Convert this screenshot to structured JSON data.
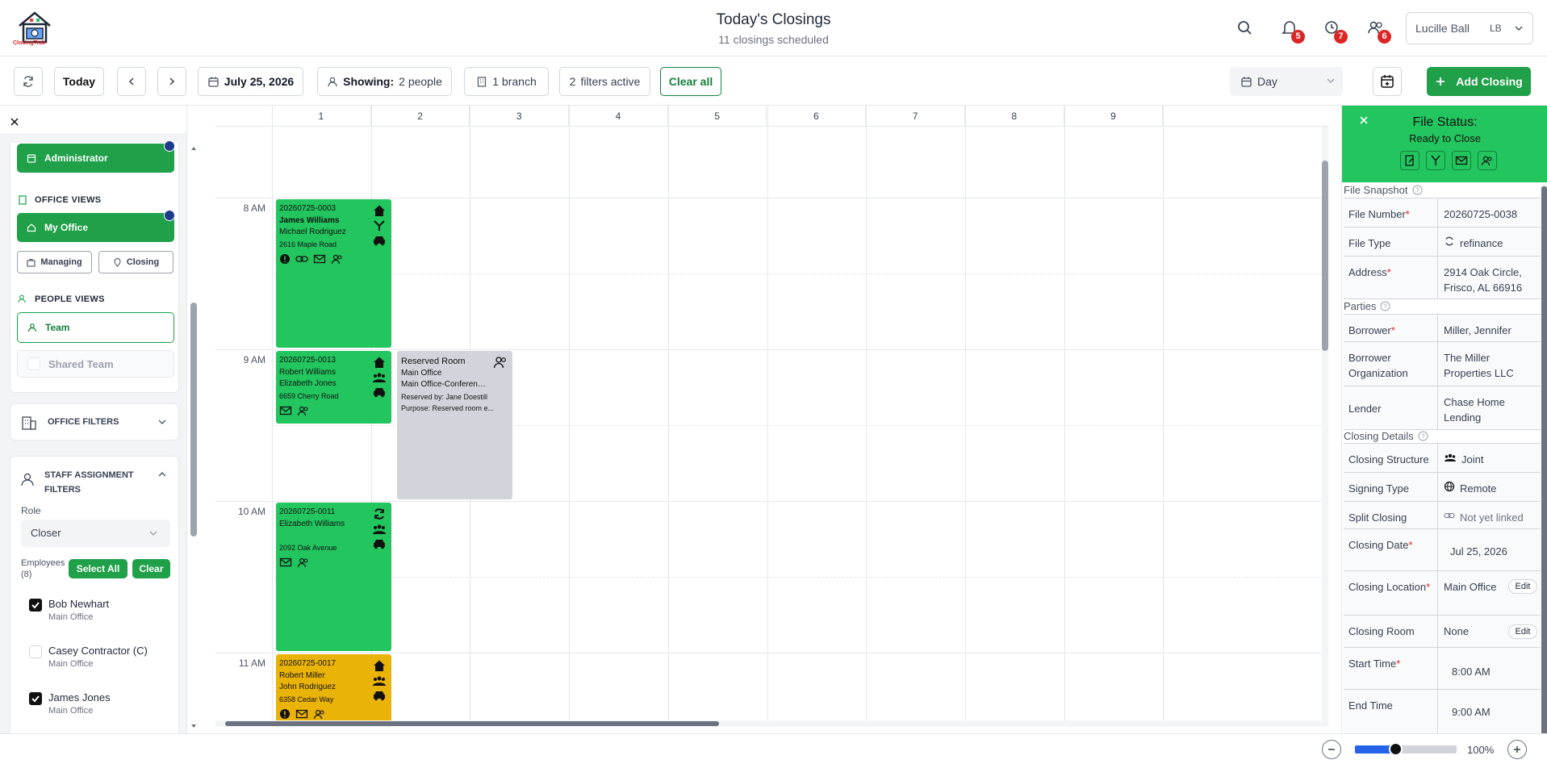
{
  "header": {
    "logo_text": "ClosingTrak",
    "title": "Today's Closings",
    "subtitle": "11 closings scheduled",
    "notifications_count": "5",
    "alerts_count": "7",
    "people_count": "6",
    "user_name": "Lucille Ball",
    "user_initials": "LB"
  },
  "toolbar": {
    "today_label": "Today",
    "date_label": "July 25, 2026",
    "showing_label": "Showing:",
    "showing_value": "2 people",
    "branch_label": "1 branch",
    "filters_count": "2",
    "filters_label": "filters active",
    "clear_all_label": "Clear all",
    "view_label": "Day",
    "add_closing_label": "Add Closing"
  },
  "sidebar": {
    "administrator_label": "Administrator",
    "office_views_label": "OFFICE VIEWS",
    "my_office_label": "My Office",
    "managing_label": "Managing",
    "closing_label": "Closing",
    "people_views_label": "PEOPLE VIEWS",
    "team_label": "Team",
    "shared_team_label": "Shared Team",
    "office_filters_label": "OFFICE FILTERS",
    "staff_filters_label": "STAFF ASSIGNMENT FILTERS",
    "role_label": "Role",
    "role_value": "Closer",
    "employees_label": "Employees",
    "employees_count": "(8)",
    "select_all_label": "Select All",
    "clear_label": "Clear",
    "employees": [
      {
        "name": "Bob Newhart",
        "office": "Main Office",
        "checked": true
      },
      {
        "name": "Casey Contractor (C)",
        "office": "Main Office",
        "checked": false
      },
      {
        "name": "James Jones",
        "office": "Main Office",
        "checked": true
      }
    ]
  },
  "calendar": {
    "columns": [
      "1",
      "2",
      "3",
      "4",
      "5",
      "6",
      "7",
      "8",
      "9"
    ],
    "times": [
      "8 AM",
      "9 AM",
      "10 AM",
      "11 AM"
    ],
    "events": [
      {
        "file": "20260725-0003",
        "line1": "James Williams",
        "line2": "Michael Rodriguez",
        "address": "2616 Maple Road",
        "color": "#22c55e"
      },
      {
        "file": "20260725-0013",
        "line1": "Robert Williams",
        "line2": "Elizabeth Jones",
        "address": "6659 Cherry Road",
        "color": "#22c55e"
      },
      {
        "file": "20260725-0011",
        "line1": "Elizabeth Williams",
        "line2": "",
        "address": "2092 Oak Avenue",
        "color": "#22c55e"
      },
      {
        "file": "20260725-0017",
        "line1": "Robert Miller",
        "line2": "John Rodriguez",
        "address": "6358 Cedar Way",
        "color": "#eab308"
      }
    ],
    "reserved": {
      "title": "Reserved Room",
      "office": "Main Office",
      "room": "Main Office-Conferenc...",
      "reserved_by": "Reserved by: Jane Doestill",
      "purpose": "Purpose: Reserved room e...",
      "color": "#d1d5db"
    }
  },
  "panel": {
    "title": "File Status:",
    "status": "Ready to Close",
    "snapshot_label": "File Snapshot",
    "file_number_label": "File Number",
    "file_number": "20260725-0038",
    "file_type_label": "File Type",
    "file_type": "refinance",
    "address_label": "Address",
    "address": "2914 Oak Circle, Frisco, AL 66916",
    "parties_label": "Parties",
    "borrower_label": "Borrower",
    "borrower": "Miller, Jennifer",
    "borrower_org_label": "Borrower Organization",
    "borrower_org": "The Miller Properties LLC",
    "lender_label": "Lender",
    "lender": "Chase Home Lending",
    "closing_details_label": "Closing Details",
    "structure_label": "Closing Structure",
    "structure": "Joint",
    "signing_label": "Signing Type",
    "signing": "Remote",
    "split_label": "Split Closing",
    "split": "Not yet linked",
    "date_label": "Closing Date",
    "date": "Jul 25, 2026",
    "location_label": "Closing Location",
    "location": "Main Office",
    "room_label": "Closing Room",
    "room": "None",
    "edit_label": "Edit",
    "start_label": "Start Time",
    "start": "8:00 AM",
    "end_label": "End Time",
    "end": "9:00 AM"
  },
  "footer": {
    "zoom": "100%",
    "zoom_fraction": 0.4
  }
}
